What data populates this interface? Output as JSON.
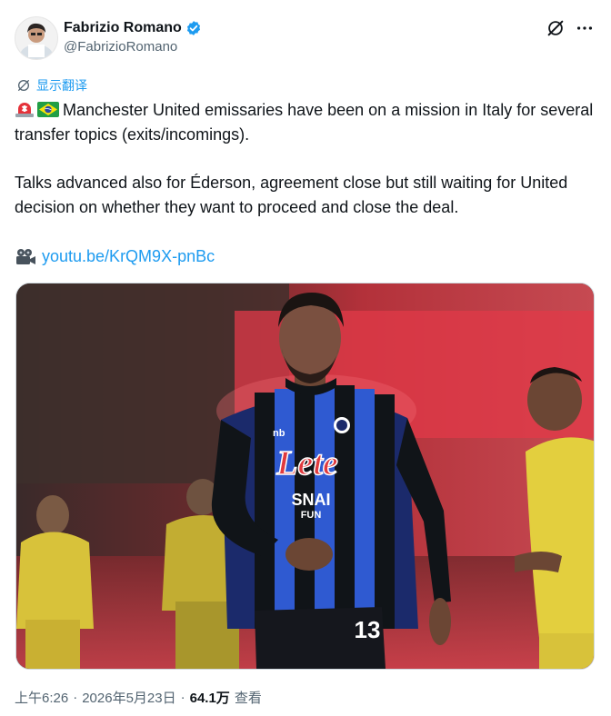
{
  "author": {
    "display_name": "Fabrizio Romano",
    "handle": "@FabrizioRomano",
    "verified": true
  },
  "actions": {
    "grok_icon": "grok-icon",
    "more_icon": "more-icon"
  },
  "translate": {
    "label": "显示翻译"
  },
  "tweet": {
    "paragraph1": "Manchester United emissaries have been on a mission in Italy for several transfer topics (exits/incomings).",
    "paragraph2": "Talks advanced also for Éderson, agreement close but still waiting for United decision on whether they want to proceed and close the deal.",
    "link": "youtu.be/KrQM9X-pnBc"
  },
  "media": {
    "shirt_sponsor": "Lete",
    "shirt_sponsor2": "SNAI",
    "shirt_sponsor3": "FUN",
    "shorts_number": "13",
    "brand_mark": "nb"
  },
  "meta": {
    "time": "上午6:26",
    "sep1": "·",
    "date": "2026年5月23日",
    "sep2": "·",
    "views": "64.1万",
    "views_label": "查看"
  },
  "colors": {
    "accent": "#1d9bf0",
    "verified": "#1d9bf0",
    "text": "#0f1419",
    "muted": "#536471"
  }
}
